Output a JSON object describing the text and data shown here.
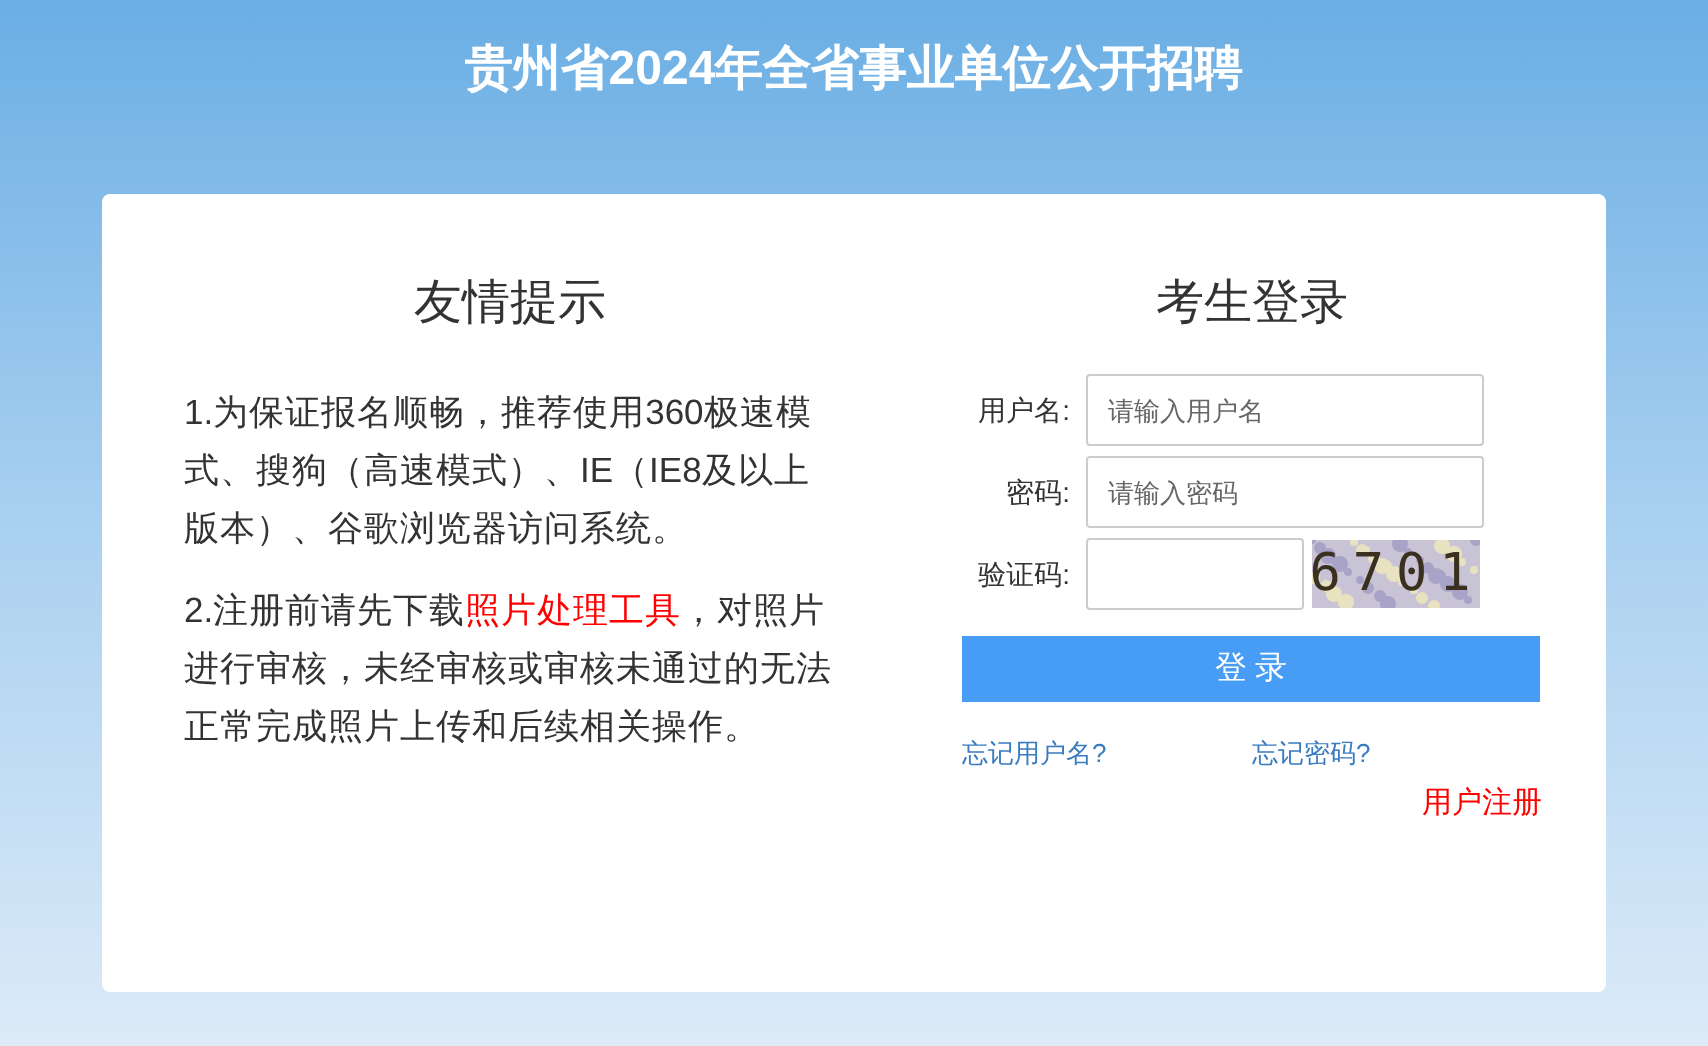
{
  "page_title": "贵州省2024年全省事业单位公开招聘",
  "notice": {
    "title": "友情提示",
    "paragraphs": [
      {
        "before": "1.为保证报名顺畅，推荐使用360极速模式、搜狗（高速模式）、IE（IE8及以上版本）、谷歌浏览器访问系统。"
      },
      {
        "before": "2.注册前请先下载",
        "link": "照片处理工具",
        "after": "，对照片进行审核，未经审核或审核未通过的无法正常完成照片上传和后续相关操作。"
      }
    ]
  },
  "login": {
    "title": "考生登录",
    "fields": [
      {
        "label": "用户名:",
        "placeholder": "请输入用户名",
        "kind": "text"
      },
      {
        "label": "密码:",
        "placeholder": "请输入密码",
        "kind": "password"
      },
      {
        "label": "验证码:",
        "kind": "captcha",
        "captcha_code": "6701"
      }
    ],
    "submit": "登 录",
    "links": [
      "忘记用户名?",
      "忘记密码?"
    ],
    "register": "用户注册"
  }
}
